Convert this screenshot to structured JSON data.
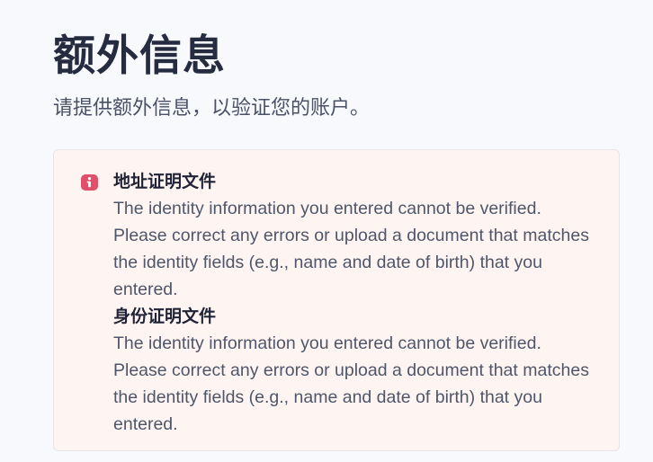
{
  "page": {
    "title": "额外信息",
    "subtitle": "请提供额外信息，以验证您的账户。"
  },
  "alert": {
    "icon": "info-icon",
    "accent_color": "#e0506a",
    "background_color": "#fef5f3",
    "sections": [
      {
        "title": "地址证明文件",
        "message": "The identity information you entered cannot be verified. Please correct any errors or upload a document that matches the identity fields (e.g., name and date of birth) that you entered."
      },
      {
        "title": "身份证明文件",
        "message": "The identity information you entered cannot be verified. Please correct any errors or upload a document that matches the identity fields (e.g., name and date of birth) that you entered."
      }
    ]
  }
}
